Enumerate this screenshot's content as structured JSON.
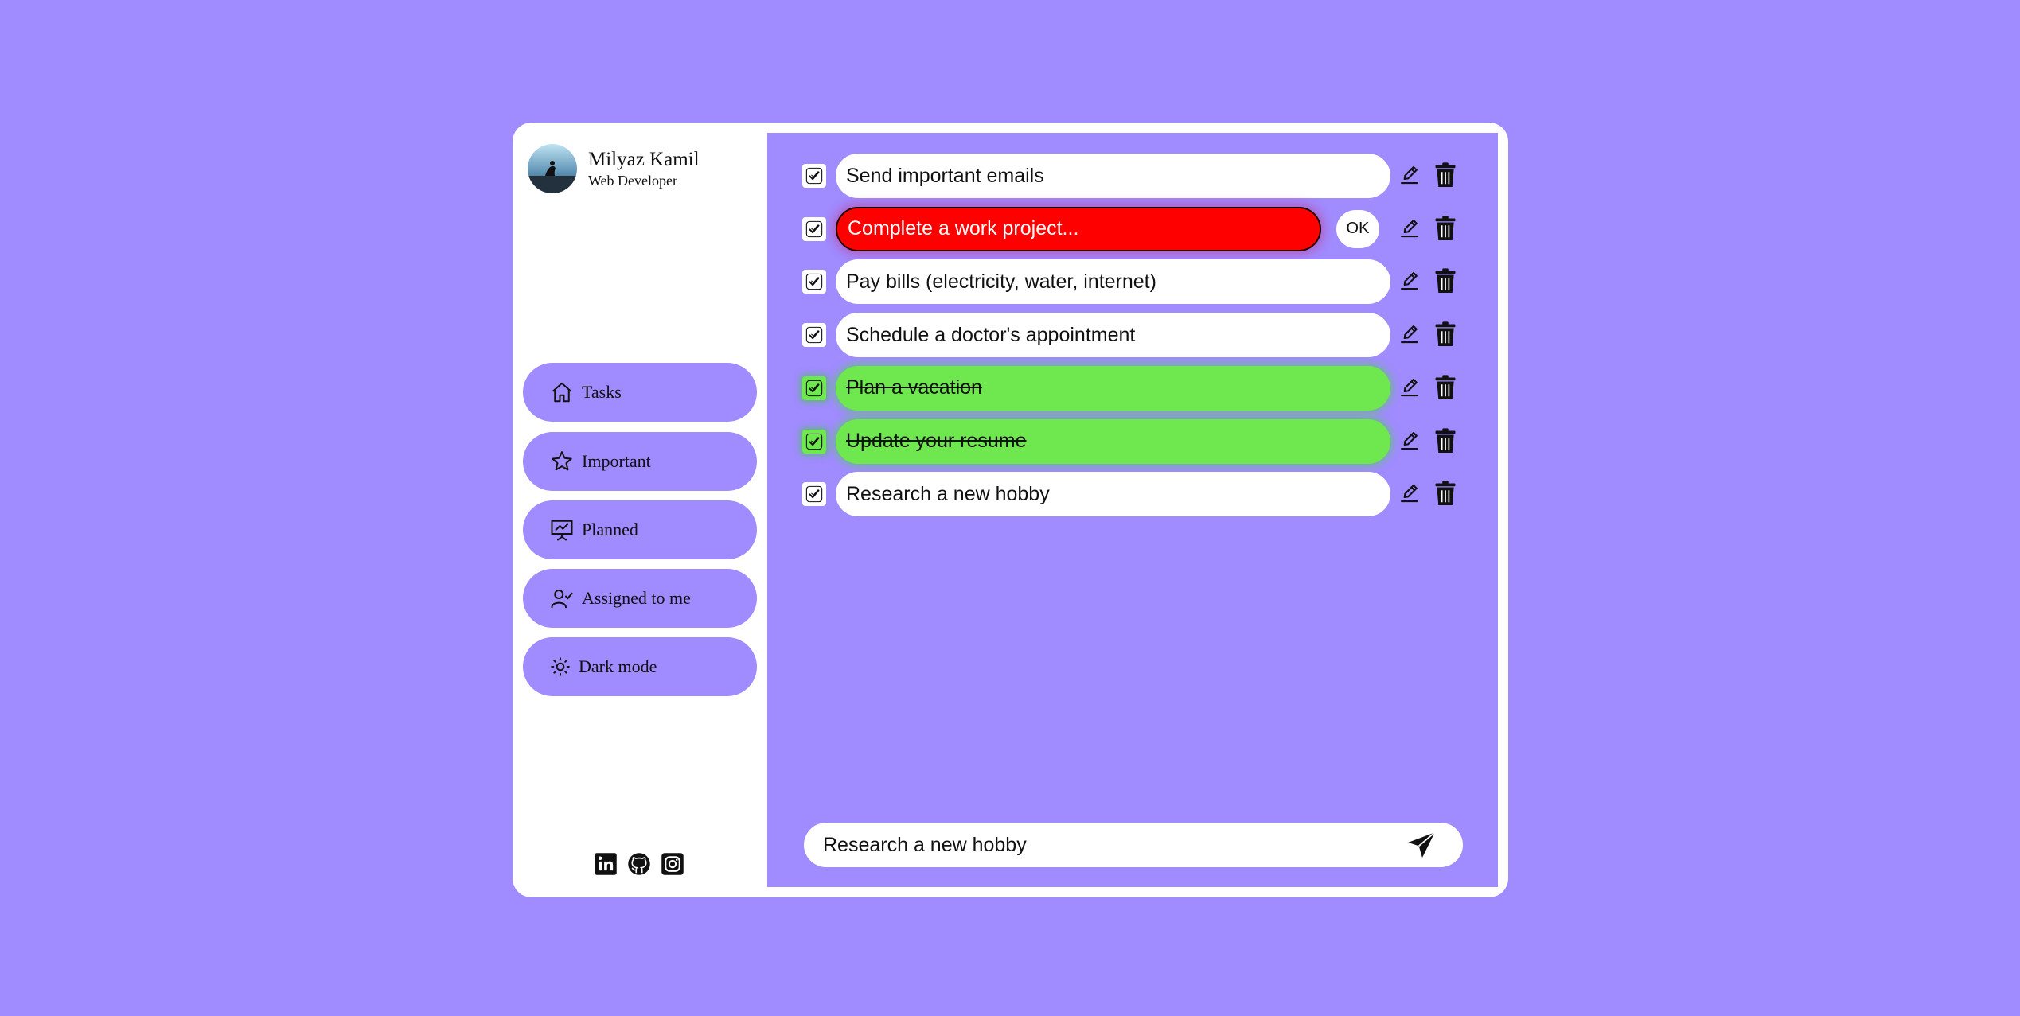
{
  "profile": {
    "name": "Milyaz Kamil",
    "role": "Web Developer"
  },
  "nav": [
    {
      "label": "Tasks",
      "icon": "home-icon"
    },
    {
      "label": "Important",
      "icon": "star-icon"
    },
    {
      "label": "Planned",
      "icon": "presentation-icon"
    },
    {
      "label": "Assigned to me",
      "icon": "user-check-icon"
    },
    {
      "label": "Dark mode",
      "icon": "sun-icon"
    }
  ],
  "socials": [
    "linkedin-icon",
    "github-icon",
    "instagram-icon"
  ],
  "tasks": [
    {
      "text": "Send important emails",
      "state": "normal"
    },
    {
      "text": "Complete a work project...",
      "state": "editing",
      "ok_label": "OK"
    },
    {
      "text": "Pay bills (electricity, water, internet)",
      "state": "normal"
    },
    {
      "text": "Schedule a doctor's appointment",
      "state": "normal"
    },
    {
      "text": "Plan a vacation",
      "state": "done"
    },
    {
      "text": "Update your resume",
      "state": "done"
    },
    {
      "text": "Research a new hobby",
      "state": "normal"
    }
  ],
  "composer": {
    "value": "Research a new hobby"
  },
  "colors": {
    "background": "#a08bff",
    "done": "#6ee84e",
    "editing": "#ff0000",
    "panel": "#ffffff"
  }
}
